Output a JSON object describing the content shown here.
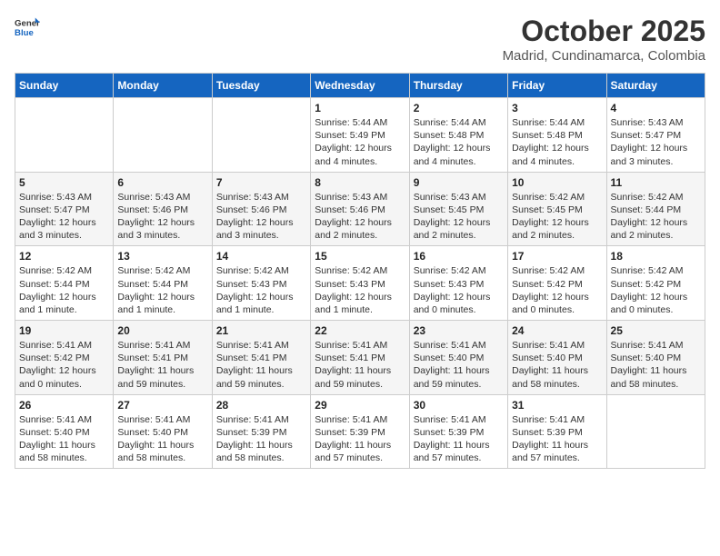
{
  "header": {
    "logo_general": "General",
    "logo_blue": "Blue",
    "month": "October 2025",
    "location": "Madrid, Cundinamarca, Colombia"
  },
  "weekdays": [
    "Sunday",
    "Monday",
    "Tuesday",
    "Wednesday",
    "Thursday",
    "Friday",
    "Saturday"
  ],
  "weeks": [
    [
      {
        "day": "",
        "info": ""
      },
      {
        "day": "",
        "info": ""
      },
      {
        "day": "",
        "info": ""
      },
      {
        "day": "1",
        "info": "Sunrise: 5:44 AM\nSunset: 5:49 PM\nDaylight: 12 hours\nand 4 minutes."
      },
      {
        "day": "2",
        "info": "Sunrise: 5:44 AM\nSunset: 5:48 PM\nDaylight: 12 hours\nand 4 minutes."
      },
      {
        "day": "3",
        "info": "Sunrise: 5:44 AM\nSunset: 5:48 PM\nDaylight: 12 hours\nand 4 minutes."
      },
      {
        "day": "4",
        "info": "Sunrise: 5:43 AM\nSunset: 5:47 PM\nDaylight: 12 hours\nand 3 minutes."
      }
    ],
    [
      {
        "day": "5",
        "info": "Sunrise: 5:43 AM\nSunset: 5:47 PM\nDaylight: 12 hours\nand 3 minutes."
      },
      {
        "day": "6",
        "info": "Sunrise: 5:43 AM\nSunset: 5:46 PM\nDaylight: 12 hours\nand 3 minutes."
      },
      {
        "day": "7",
        "info": "Sunrise: 5:43 AM\nSunset: 5:46 PM\nDaylight: 12 hours\nand 3 minutes."
      },
      {
        "day": "8",
        "info": "Sunrise: 5:43 AM\nSunset: 5:46 PM\nDaylight: 12 hours\nand 2 minutes."
      },
      {
        "day": "9",
        "info": "Sunrise: 5:43 AM\nSunset: 5:45 PM\nDaylight: 12 hours\nand 2 minutes."
      },
      {
        "day": "10",
        "info": "Sunrise: 5:42 AM\nSunset: 5:45 PM\nDaylight: 12 hours\nand 2 minutes."
      },
      {
        "day": "11",
        "info": "Sunrise: 5:42 AM\nSunset: 5:44 PM\nDaylight: 12 hours\nand 2 minutes."
      }
    ],
    [
      {
        "day": "12",
        "info": "Sunrise: 5:42 AM\nSunset: 5:44 PM\nDaylight: 12 hours\nand 1 minute."
      },
      {
        "day": "13",
        "info": "Sunrise: 5:42 AM\nSunset: 5:44 PM\nDaylight: 12 hours\nand 1 minute."
      },
      {
        "day": "14",
        "info": "Sunrise: 5:42 AM\nSunset: 5:43 PM\nDaylight: 12 hours\nand 1 minute."
      },
      {
        "day": "15",
        "info": "Sunrise: 5:42 AM\nSunset: 5:43 PM\nDaylight: 12 hours\nand 1 minute."
      },
      {
        "day": "16",
        "info": "Sunrise: 5:42 AM\nSunset: 5:43 PM\nDaylight: 12 hours\nand 0 minutes."
      },
      {
        "day": "17",
        "info": "Sunrise: 5:42 AM\nSunset: 5:42 PM\nDaylight: 12 hours\nand 0 minutes."
      },
      {
        "day": "18",
        "info": "Sunrise: 5:42 AM\nSunset: 5:42 PM\nDaylight: 12 hours\nand 0 minutes."
      }
    ],
    [
      {
        "day": "19",
        "info": "Sunrise: 5:41 AM\nSunset: 5:42 PM\nDaylight: 12 hours\nand 0 minutes."
      },
      {
        "day": "20",
        "info": "Sunrise: 5:41 AM\nSunset: 5:41 PM\nDaylight: 11 hours\nand 59 minutes."
      },
      {
        "day": "21",
        "info": "Sunrise: 5:41 AM\nSunset: 5:41 PM\nDaylight: 11 hours\nand 59 minutes."
      },
      {
        "day": "22",
        "info": "Sunrise: 5:41 AM\nSunset: 5:41 PM\nDaylight: 11 hours\nand 59 minutes."
      },
      {
        "day": "23",
        "info": "Sunrise: 5:41 AM\nSunset: 5:40 PM\nDaylight: 11 hours\nand 59 minutes."
      },
      {
        "day": "24",
        "info": "Sunrise: 5:41 AM\nSunset: 5:40 PM\nDaylight: 11 hours\nand 58 minutes."
      },
      {
        "day": "25",
        "info": "Sunrise: 5:41 AM\nSunset: 5:40 PM\nDaylight: 11 hours\nand 58 minutes."
      }
    ],
    [
      {
        "day": "26",
        "info": "Sunrise: 5:41 AM\nSunset: 5:40 PM\nDaylight: 11 hours\nand 58 minutes."
      },
      {
        "day": "27",
        "info": "Sunrise: 5:41 AM\nSunset: 5:40 PM\nDaylight: 11 hours\nand 58 minutes."
      },
      {
        "day": "28",
        "info": "Sunrise: 5:41 AM\nSunset: 5:39 PM\nDaylight: 11 hours\nand 58 minutes."
      },
      {
        "day": "29",
        "info": "Sunrise: 5:41 AM\nSunset: 5:39 PM\nDaylight: 11 hours\nand 57 minutes."
      },
      {
        "day": "30",
        "info": "Sunrise: 5:41 AM\nSunset: 5:39 PM\nDaylight: 11 hours\nand 57 minutes."
      },
      {
        "day": "31",
        "info": "Sunrise: 5:41 AM\nSunset: 5:39 PM\nDaylight: 11 hours\nand 57 minutes."
      },
      {
        "day": "",
        "info": ""
      }
    ]
  ]
}
